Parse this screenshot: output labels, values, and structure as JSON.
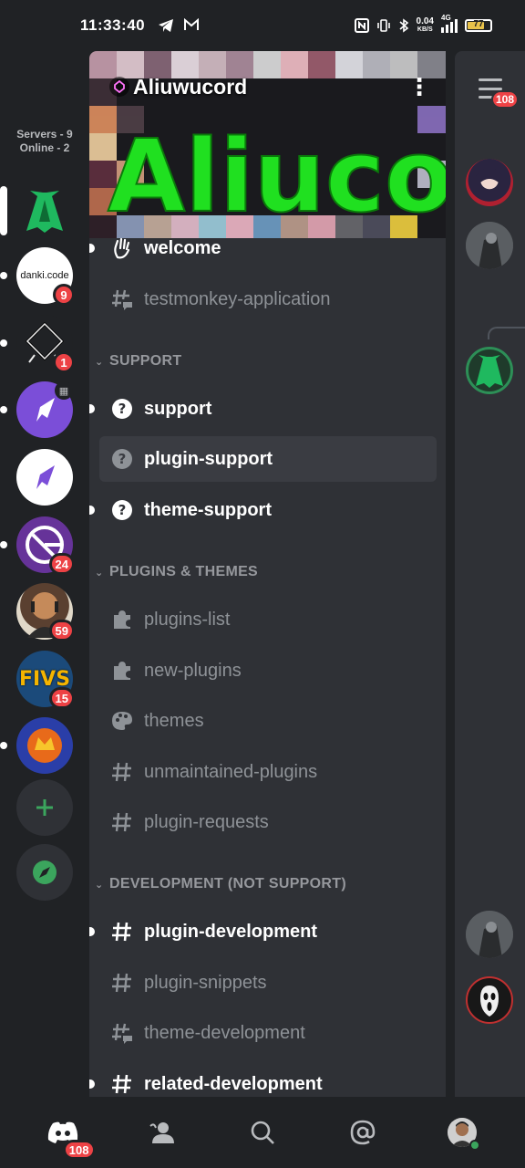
{
  "status_bar": {
    "time": "11:33:40",
    "net_speed_value": "0.04",
    "net_speed_unit": "KB/S",
    "network_type": "4G",
    "battery_level": "77",
    "battery_fraction": 0.77,
    "icons": [
      "telegram-icon",
      "gmail-icon",
      "nfc-icon",
      "vibrate-icon",
      "bluetooth-icon",
      "signal-icon"
    ]
  },
  "server_rail": {
    "summary_line1": "Servers - 9",
    "summary_line2": "Online - 2",
    "servers": [
      {
        "name": "Aliucord",
        "badge": "",
        "selected": true,
        "unread": false
      },
      {
        "name": "danki.code",
        "logo_text": "danki.code",
        "badge": "9",
        "unread": true
      },
      {
        "name": "Android server",
        "badge": "1",
        "unread": true
      },
      {
        "name": "Purple rocket server",
        "badge": "",
        "unread": true,
        "has_event": true
      },
      {
        "name": "White rocket server",
        "badge": "",
        "unread": false
      },
      {
        "name": "Gatsby server",
        "badge": "24",
        "unread": true
      },
      {
        "name": "Person avatar server",
        "badge": "59",
        "unread": false
      },
      {
        "name": "FIVS",
        "logo_text": "FIVS",
        "badge": "15",
        "unread": false
      },
      {
        "name": "Monster server",
        "badge": "",
        "unread": true
      }
    ],
    "add_server_icon": "plus-icon",
    "explore_icon": "compass-icon"
  },
  "channel_panel": {
    "server_name": "Aliuwucord",
    "banner_text": "Aliucord",
    "categories": [
      {
        "label": "SUPPORT"
      },
      {
        "label": "PLUGINS & THEMES"
      },
      {
        "label": "DEVELOPMENT (NOT SUPPORT)"
      }
    ],
    "channels": [
      {
        "name": "welcome",
        "icon": "wave-icon",
        "unread": true
      },
      {
        "name": "testmonkey-application",
        "icon": "thread-hash-icon",
        "unread": false
      },
      {
        "name": "support",
        "icon": "question-icon",
        "unread": true
      },
      {
        "name": "plugin-support",
        "icon": "question-icon",
        "unread": false,
        "active": true
      },
      {
        "name": "theme-support",
        "icon": "question-icon",
        "unread": true
      },
      {
        "name": "plugins-list",
        "icon": "puzzle-icon",
        "unread": false
      },
      {
        "name": "new-plugins",
        "icon": "puzzle-icon",
        "unread": false
      },
      {
        "name": "themes",
        "icon": "palette-icon",
        "unread": false
      },
      {
        "name": "unmaintained-plugins",
        "icon": "hash-icon",
        "unread": false
      },
      {
        "name": "plugin-requests",
        "icon": "hash-icon",
        "unread": false
      },
      {
        "name": "plugin-development",
        "icon": "hash-icon",
        "unread": true
      },
      {
        "name": "plugin-snippets",
        "icon": "hash-icon",
        "unread": false
      },
      {
        "name": "theme-development",
        "icon": "thread-hash-icon",
        "unread": false
      },
      {
        "name": "related-development",
        "icon": "hash-icon",
        "unread": true
      }
    ]
  },
  "member_rail": {
    "menu_badge": "108"
  },
  "bottom_nav": {
    "home_badge": "108",
    "items": [
      "home-icon",
      "friends-icon",
      "search-icon",
      "mentions-icon",
      "profile-avatar"
    ]
  },
  "colors": {
    "background": "#202225",
    "panel": "#2f3136",
    "badge": "#ed4245",
    "brand_green": "#3ba55d",
    "aliucord_green": "#1fb95f"
  }
}
